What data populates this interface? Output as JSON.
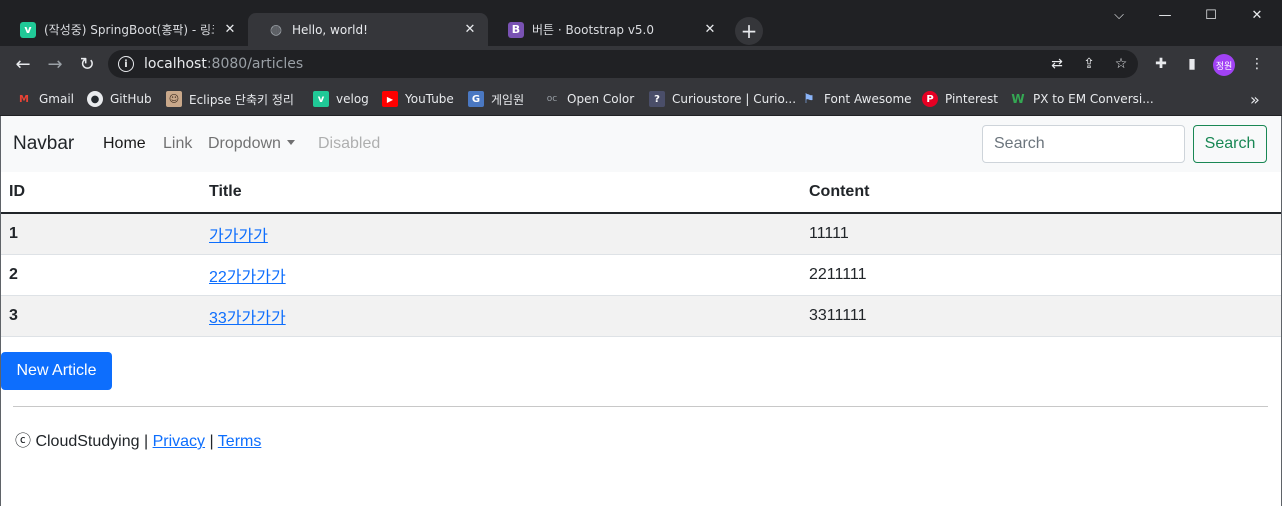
{
  "browser": {
    "tabs": [
      {
        "title": "(작성중) SpringBoot(홍팍) - 링크",
        "favicon": "velog-icon",
        "favicon_text": "v",
        "favicon_color": "#20c997",
        "active": false
      },
      {
        "title": "Hello, world!",
        "favicon": "globe-icon",
        "favicon_text": "◍",
        "favicon_color": "#9aa0a6",
        "active": true
      },
      {
        "title": "버튼 · Bootstrap v5.0",
        "favicon": "bootstrap-icon",
        "favicon_text": "B",
        "favicon_color": "#7952b3",
        "active": false
      }
    ],
    "newtab_label": "+",
    "url_host": "localhost",
    "url_path": ":8080/articles",
    "profile_initials": "정원",
    "bookmarks": [
      {
        "label": "Gmail",
        "icon": "gmail-icon",
        "icon_text": "M",
        "color": "#ea4335"
      },
      {
        "label": "GitHub",
        "icon": "github-icon",
        "icon_text": "●",
        "color": "#24292e"
      },
      {
        "label": "Eclipse 단축키 정리",
        "icon": "avatar-icon",
        "icon_text": "☺",
        "color": "#7a5c48"
      },
      {
        "label": "velog",
        "icon": "velog-icon",
        "icon_text": "v",
        "color": "#20c997"
      },
      {
        "label": "YouTube",
        "icon": "youtube-icon",
        "icon_text": "▶",
        "color": "#ff0000"
      },
      {
        "label": "게임원",
        "icon": "g-icon",
        "icon_text": "G",
        "color": "#4a78c2"
      },
      {
        "label": "Open Color",
        "icon": "opencolor-icon",
        "icon_text": "oc",
        "color": "#35363a"
      },
      {
        "label": "Curioustore | Curio...",
        "icon": "curio-icon",
        "icon_text": "?",
        "color": "#4a4e69"
      },
      {
        "label": "Font Awesome",
        "icon": "flag-icon",
        "icon_text": "⚑",
        "color": "#35363a"
      },
      {
        "label": "Pinterest",
        "icon": "pinterest-icon",
        "icon_text": "P",
        "color": "#e60023"
      },
      {
        "label": "PX to EM Conversi...",
        "icon": "w-icon",
        "icon_text": "W",
        "color": "#35363a"
      }
    ],
    "more_bookmarks": "»"
  },
  "navbar": {
    "brand": "Navbar",
    "links": {
      "home": "Home",
      "link": "Link",
      "dropdown": "Dropdown",
      "disabled": "Disabled"
    },
    "search_placeholder": "Search",
    "search_button": "Search"
  },
  "table": {
    "headers": {
      "id": "ID",
      "title": "Title",
      "content": "Content"
    },
    "rows": [
      {
        "id": "1",
        "title": "가가가가",
        "content": "11111"
      },
      {
        "id": "2",
        "title": "22가가가가",
        "content": "2211111"
      },
      {
        "id": "3",
        "title": "33가가가가",
        "content": "3311111"
      }
    ]
  },
  "new_article_button": "New Article",
  "footer": {
    "copyright": "ⓒ CloudStudying |",
    "privacy": "Privacy",
    "separator": "|",
    "terms": "Terms"
  },
  "colors": {
    "primary": "#0d6efd",
    "success": "#198754",
    "chrome_dark": "#202124",
    "chrome_toolbar": "#35363a"
  }
}
